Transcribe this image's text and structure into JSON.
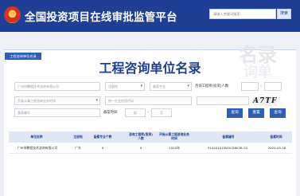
{
  "header": {
    "site_title": "全国投资项目在线审批监管平台",
    "search_placeholder": "请输入关键词搜索",
    "search_button": "搜索"
  },
  "breadcrumb": "工程咨询单位名录",
  "page_title": "工程咨询单位名录",
  "watermark": [
    "名录",
    "询单"
  ],
  "filters": {
    "unit_name": "广州市鹏程技术咨询有限公司",
    "region": "注册地",
    "specialty": "备案专业",
    "years_label": "咨询工程师(投资)人数:",
    "business": "开展从事工程咨询业务时间",
    "credit_code": "统一社会信用代码",
    "record_no": "备案编号",
    "record_time_label": "备案时间:",
    "date_from": "起",
    "date_to": "至",
    "captcha": "A7TF"
  },
  "buttons": {
    "query": "查询",
    "reset": "重置",
    "search": "查询"
  },
  "table": {
    "headers": [
      "单位名称",
      "注册地",
      "备案专业个数",
      "咨询工程师(投资)人数",
      "开始从事工程咨询业务时间",
      "备案编号",
      "备案时间"
    ],
    "rows": [
      [
        "广州市鹏程技术咨询有限公司",
        "广东",
        "9",
        "9",
        "2020年",
        "91440101MA5CR8K38-20",
        "2020-05-16"
      ]
    ]
  }
}
